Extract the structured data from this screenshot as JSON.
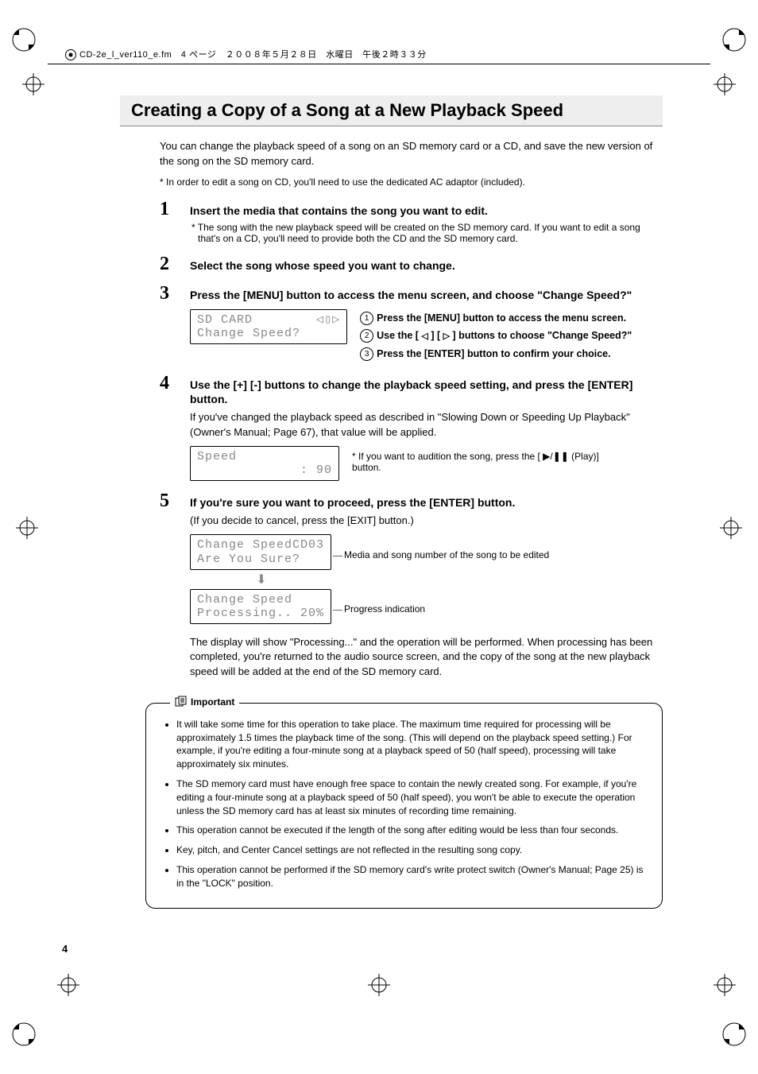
{
  "header_line": "CD-2e_l_ver110_e.fm　4 ページ　２００８年５月２８日　水曜日　午後２時３３分",
  "title": "Creating a Copy of a Song at a New Playback Speed",
  "intro": "You can change the playback speed of a song on an SD memory card or a CD, and save the new version of the song on the SD memory card.",
  "intro_note": "* In order to edit a song on CD, you'll need to use the dedicated AC adaptor (included).",
  "steps": [
    {
      "num": "1",
      "head": "Insert the media that contains the song you want to edit.",
      "note": "* The song with the new playback speed will be created on the SD memory card. If you want to edit a song that's on a CD, you'll need to provide both the CD and the SD memory card."
    },
    {
      "num": "2",
      "head": "Select the song whose speed you want to change."
    },
    {
      "num": "3",
      "head": "Press the [MENU] button to access the menu screen, and choose \"Change Speed?\"",
      "lcd1_line1": "SD CARD        ◁▯▷",
      "lcd1_line2": "Change Speed?",
      "sub1": "Press the [MENU] button to access the menu screen.",
      "sub2a": "Use the [ ",
      "sub2b": " ] [ ",
      "sub2c": " ] buttons to choose \"Change Speed?\"",
      "sub3": "Press the [ENTER] button to confirm your choice."
    },
    {
      "num": "4",
      "head": "Use the [+] [-] buttons to change the playback speed setting, and press the [ENTER] button.",
      "body": "If you've changed the playback speed as described in \"Slowing Down or Speeding Up Playback\" (Owner's Manual; Page 67), that value will be applied.",
      "lcd2_line1": "Speed",
      "lcd2_line2": "             : 90",
      "side_note": "* If you want to audition the song, press the [ ▶/❚❚ (Play)] button."
    },
    {
      "num": "5",
      "head": "If you're sure you want to proceed, press the [ENTER] button.",
      "sub_body": "(If you decide to cancel, press the [EXIT] button.)",
      "lcd3_line1": "Change SpeedCD03",
      "lcd3_line2": "Are You Sure?",
      "cap3": "Media and song number of the song to be edited",
      "lcd4_line1": "Change Speed",
      "lcd4_line2": "Processing.. 20%",
      "cap4": "Progress indication",
      "after": "The display will show \"Processing...\" and the operation will be performed. When processing has been completed, you're returned to the audio source screen, and the copy of the song at the new playback speed will be added at the end of the SD memory card."
    }
  ],
  "important_label": "Important",
  "important": [
    "It will take some time for this operation to take place. The maximum time required for processing will be approximately 1.5 times the playback time of the song. (This will depend on the playback speed setting.) For example, if you're editing a four-minute song at a playback speed of 50 (half speed), processing will take approximately six minutes.",
    "The SD memory card must have enough free space to contain the newly created song. For example, if you're editing a four-minute song at a playback speed of 50 (half speed), you won't be able to execute the operation unless the SD memory card has at least six minutes of recording time remaining.",
    "This operation cannot be executed if the length of the song after editing would be less than four seconds.",
    "Key, pitch, and Center Cancel settings are not reflected in the resulting song copy.",
    "This operation cannot be performed if the SD memory card's write protect switch (Owner's Manual; Page 25) is in the \"LOCK\" position."
  ],
  "page_num": "4"
}
